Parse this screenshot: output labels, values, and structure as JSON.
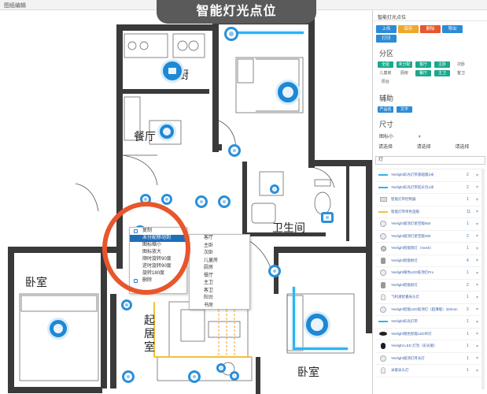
{
  "window": {
    "title": "图纸编辑"
  },
  "banner": {
    "text": "智能灯光点位"
  },
  "rooms": {
    "kitchen": "厨",
    "dining": "餐厅",
    "bath": "卫生间",
    "bedroom_left": "卧室",
    "living": "起居室",
    "bedroom_right": "卧室"
  },
  "context_menu": {
    "items": [
      "复制",
      "未分配移动到",
      "图标缩小",
      "图标放大",
      "顺时旋转90度",
      "逆时旋转90度",
      "旋转180度",
      "删除"
    ],
    "selected": "未分配移动到"
  },
  "submenu": {
    "items": [
      "客厅",
      "主卧",
      "次卧",
      "儿童房",
      "厨房",
      "餐厅",
      "主卫",
      "客卫",
      "阳台",
      "书房",
      "阳台"
    ]
  },
  "panel": {
    "header": "智能灯光点位",
    "toolbar": [
      {
        "label": "上传",
        "color": "#2d8bd6"
      },
      {
        "label": "保存",
        "color": "#f0a82a"
      },
      {
        "label": "删除",
        "color": "#e8562c"
      },
      {
        "label": "导出",
        "color": "#2d8bd6"
      },
      {
        "label": "打印",
        "color": "#2d8bd6"
      }
    ],
    "section_zone": "分区",
    "zones": [
      {
        "label": "全屋",
        "on": true
      },
      {
        "label": "未分配",
        "on": true
      },
      {
        "label": "客厅",
        "on": true
      },
      {
        "label": "主卧",
        "on": true
      },
      {
        "label": "次卧",
        "on": false
      },
      {
        "label": "儿童房",
        "on": false
      },
      {
        "label": "厨房",
        "on": false
      },
      {
        "label": "餐厅",
        "on": true
      },
      {
        "label": "主卫",
        "on": true
      },
      {
        "label": "客卫",
        "on": false
      },
      {
        "label": "阳台",
        "on": false
      }
    ],
    "section_aux": "辅助",
    "aux": [
      {
        "label": "产品名",
        "on": true
      },
      {
        "label": "文字",
        "on": true
      }
    ],
    "section_size": "尺寸",
    "size_value": "图标小",
    "filters": [
      "请选择",
      "请选择",
      "请选择"
    ],
    "left_filter": "请选择",
    "search_value": "灯"
  },
  "products": [
    {
      "name": "Yeelight彩光灯带基础版2米",
      "count": "2",
      "kind": "strip"
    },
    {
      "name": "Yeelight彩光灯带延长包1米",
      "count": "2",
      "kind": "strip"
    },
    {
      "name": "智能灯带控制器",
      "count": "1",
      "kind": "box"
    },
    {
      "name": "智能灯带单色温版",
      "count": "11",
      "kind": "strip-y"
    },
    {
      "name": "Yeelight吸顶灯星空版650",
      "count": "1",
      "kind": "ceil"
    },
    {
      "name": "Yeelight吸顶灯星空版480",
      "count": "2",
      "kind": "ceil"
    },
    {
      "name": "Yeelight智能筒灯（mesh）",
      "count": "1",
      "kind": "down"
    },
    {
      "name": "Yeelight智能射灯",
      "count": "4",
      "kind": "spot"
    },
    {
      "name": "Yeelight银色LED吸顶灯Pro",
      "count": "1",
      "kind": "ceil"
    },
    {
      "name": "Yeelight智能射灯",
      "count": "2",
      "kind": "spot"
    },
    {
      "name": "飞利浦智睿床头灯",
      "count": "1",
      "kind": "lamp"
    },
    {
      "name": "Yeelight智能LED吸顶灯（超薄版）320mm",
      "count": "2",
      "kind": "ceil"
    },
    {
      "name": "Yeelight彩光灯带",
      "count": "1",
      "kind": "strip"
    },
    {
      "name": "Yeelight银色智能LED吊灯",
      "count": "1",
      "kind": "pend"
    },
    {
      "name": "Yeelight LED 灯泡（彩光版）",
      "count": "1",
      "kind": "bulb"
    },
    {
      "name": "Yeelight吸顶灯月光灯",
      "count": "1",
      "kind": "ceil"
    },
    {
      "name": "米家床头灯",
      "count": "1",
      "kind": "lamp"
    }
  ]
}
